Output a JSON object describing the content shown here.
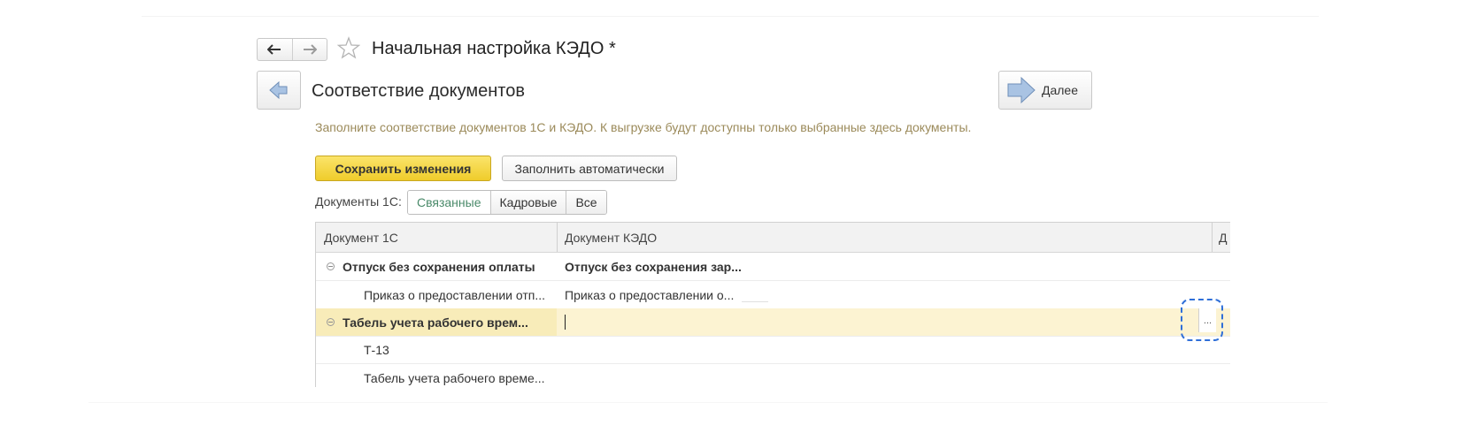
{
  "window": {
    "title": "Начальная настройка КЭДО *",
    "subtitle": "Соответствие документов",
    "next_label": "Далее"
  },
  "hint": "Заполните соответствие документов 1С и КЭДО. К выгрузке будут доступны только выбранные здесь документы.",
  "buttons": {
    "save": "Сохранить изменения",
    "auto": "Заполнить автоматически"
  },
  "filter": {
    "label": "Документы 1С:",
    "options": [
      "Связанные",
      "Кадровые",
      "Все"
    ],
    "selected": "Связанные"
  },
  "table": {
    "columns": [
      "Документ 1С",
      "Документ КЭДО",
      "Д"
    ],
    "rows": [
      {
        "doc1c": "Отпуск без сохранения оплаты",
        "kedo": "Отпуск без сохранения зар...",
        "group": true
      },
      {
        "doc1c": "Приказ о предоставлении отп...",
        "kedo": "Приказ о предоставлении о...",
        "group": false
      },
      {
        "doc1c": "Табель учета рабочего врем...",
        "kedo": "",
        "group": true,
        "selected": true
      },
      {
        "doc1c": "Т-13",
        "kedo": "",
        "group": false
      },
      {
        "doc1c": "Табель учета рабочего време...",
        "kedo": "",
        "group": false
      }
    ],
    "select_button": "..."
  },
  "colors": {
    "save_button": "#f5d84a",
    "selected_row": "#fcf3d2",
    "hint_text": "#9b8a5a",
    "highlight": "#2f6fd8"
  }
}
